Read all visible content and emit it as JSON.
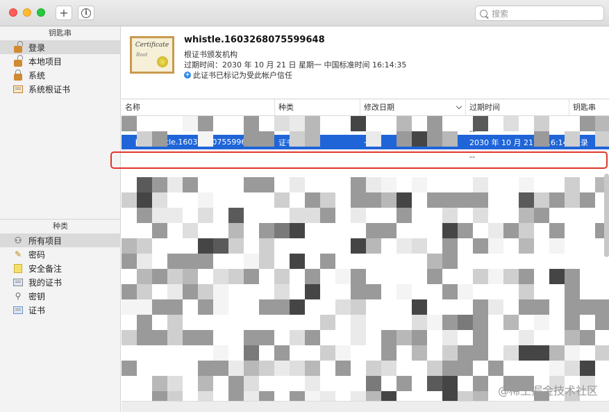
{
  "search": {
    "placeholder": "搜索"
  },
  "sidebar": {
    "keychains_header": "钥匙串",
    "keychains": [
      {
        "label": "登录",
        "icon": "lock-open-icon",
        "selected": true
      },
      {
        "label": "本地项目",
        "icon": "lock-open-icon",
        "selected": false
      },
      {
        "label": "系统",
        "icon": "lock-icon",
        "selected": false
      },
      {
        "label": "系统根证书",
        "icon": "certificate-cabinet-icon",
        "selected": false
      }
    ],
    "category_header": "种类",
    "categories": [
      {
        "label": "所有项目",
        "icon": "people-icon",
        "selected": true
      },
      {
        "label": "密码",
        "icon": "pencil-icon",
        "selected": false
      },
      {
        "label": "安全备注",
        "icon": "note-icon",
        "selected": false
      },
      {
        "label": "我的证书",
        "icon": "my-certificate-icon",
        "selected": false
      },
      {
        "label": "密钥",
        "icon": "key-icon",
        "selected": false
      },
      {
        "label": "证书",
        "icon": "certificate-icon",
        "selected": false
      }
    ]
  },
  "detail": {
    "cert_text": "Certificate",
    "cert_sub": "Root",
    "title": "whistle.1603268075599648",
    "subtitle": "根证书颁发机构",
    "expiry": "过期时间：2030 年 10 月 21 日 星期一 中国标准时间 16:14:35",
    "trust": "此证书已标记为受此帐户信任"
  },
  "table": {
    "headers": {
      "name": "名称",
      "kind": "种类",
      "modified": "修改日期",
      "expires": "过期时间",
      "keychain": "钥匙串"
    },
    "selected_row": {
      "name": "whistle.1603268075599648",
      "kind": "证书",
      "modified": "--",
      "expires": "2030 年 10 月 21 日 16:14:35",
      "keychain": "登录"
    },
    "other_rows_partial": [
      {
        "modified": "",
        "expires": "--"
      },
      {
        "modified": "",
        "expires": "--"
      }
    ]
  },
  "watermark": "@稀土掘金技术社区",
  "colors": {
    "selection": "#1f65d8",
    "highlight": "#e0362c"
  }
}
